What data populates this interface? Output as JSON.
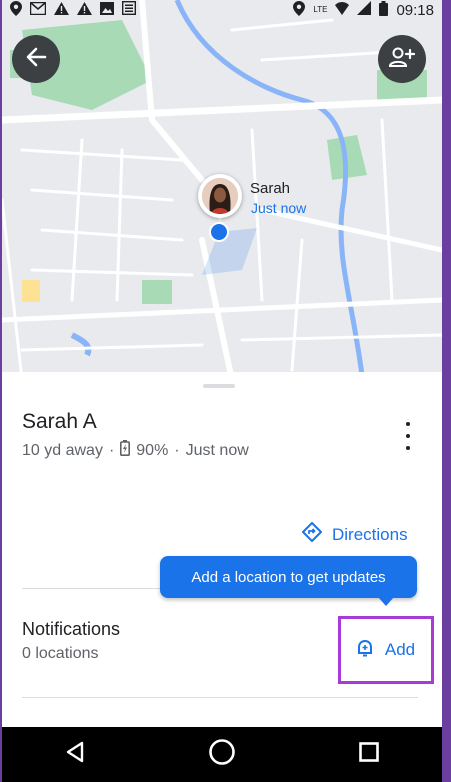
{
  "status_bar": {
    "time": "09:18",
    "net_label": "LTE",
    "icons": [
      "location-icon",
      "gmail-icon",
      "warning-icon",
      "warning-icon",
      "image-icon",
      "news-icon",
      "location-icon",
      "wifi-icon",
      "signal-icon",
      "battery-icon"
    ]
  },
  "map": {
    "pin_name": "Sarah",
    "pin_time": "Just now",
    "colors": {
      "road": "#ffffff",
      "land": "#e8eaed",
      "park": "#a8dab5",
      "water": "#8ab4f8",
      "accent": "#1a73e8"
    }
  },
  "sheet": {
    "person_name": "Sarah A",
    "distance": "10 yd away",
    "separator": "·",
    "battery": "90%",
    "updated": "Just now",
    "directions_label": "Directions",
    "tooltip": "Add a location to get updates",
    "notifications_title": "Notifications",
    "notifications_count": "0 locations",
    "add_label": "Add"
  },
  "navbar": {
    "buttons": [
      "back-icon",
      "home-icon",
      "recents-icon"
    ]
  }
}
